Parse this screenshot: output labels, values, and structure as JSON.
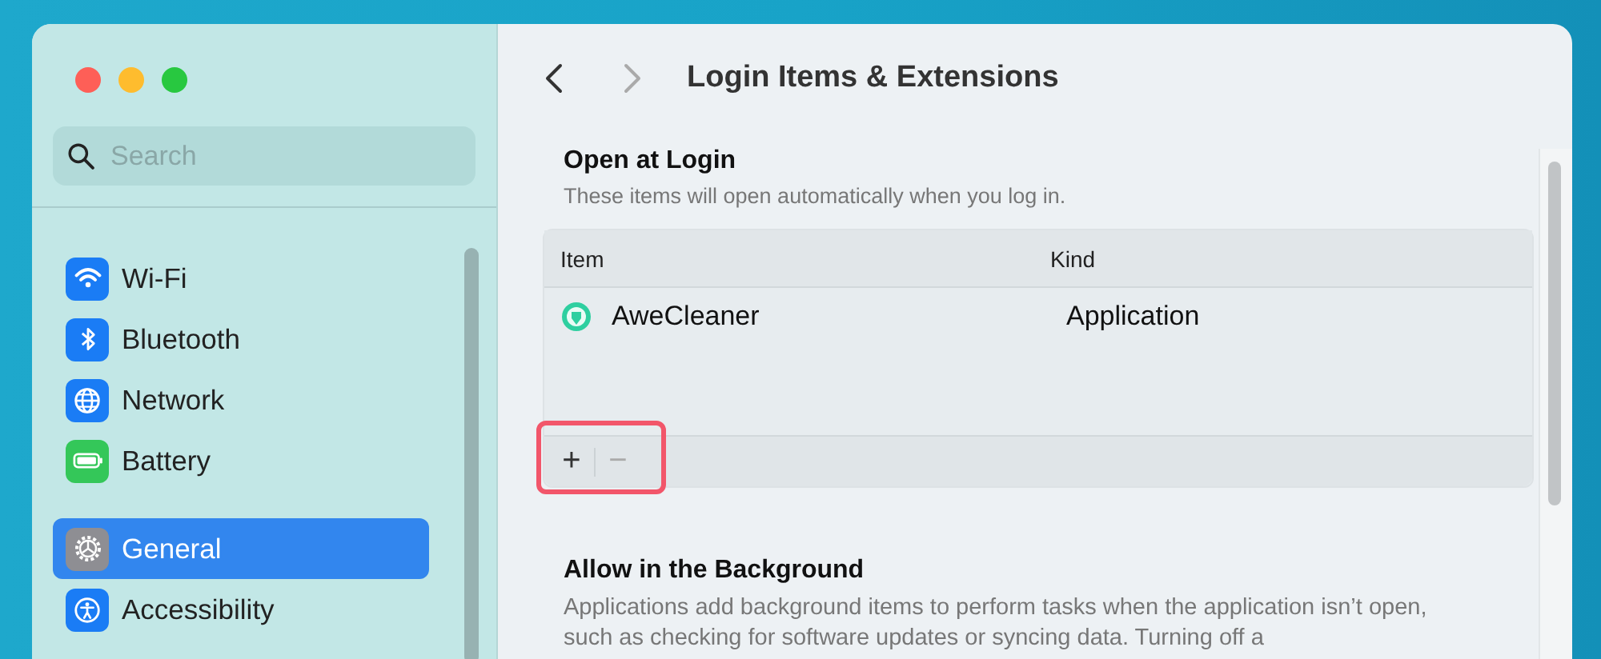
{
  "sidebar": {
    "search": {
      "placeholder": "Search"
    },
    "groups": [
      [
        {
          "label": "Wi-Fi",
          "kind": "wifi",
          "color": "#1a7cf5",
          "selected": false
        },
        {
          "label": "Bluetooth",
          "kind": "bluetooth",
          "color": "#1a7cf5",
          "selected": false
        },
        {
          "label": "Network",
          "kind": "globe",
          "color": "#1a7cf5",
          "selected": false
        },
        {
          "label": "Battery",
          "kind": "battery",
          "color": "#34c759",
          "selected": false
        }
      ],
      [
        {
          "label": "General",
          "kind": "gear",
          "color": "#8e8e93",
          "selected": true
        },
        {
          "label": "Accessibility",
          "kind": "person",
          "color": "#1a7cf5",
          "selected": false
        }
      ]
    ]
  },
  "header": {
    "title": "Login Items & Extensions"
  },
  "open_at_login": {
    "title": "Open at Login",
    "subtitle": "These items will open automatically when you log in.",
    "table": {
      "columns": [
        "Item",
        "Kind"
      ],
      "rows": [
        {
          "name": "AweCleaner",
          "kind": "Application"
        }
      ],
      "buttons": [
        {
          "label": "+",
          "disabled": false
        },
        {
          "label": "−",
          "disabled": true
        }
      ],
      "buttons_highlighted": true
    }
  },
  "background": {
    "title": "Allow in the Background",
    "text": "Applications add background items to perform tasks when the application isn’t open, such as checking for software updates or syncing data. Turning off a"
  }
}
